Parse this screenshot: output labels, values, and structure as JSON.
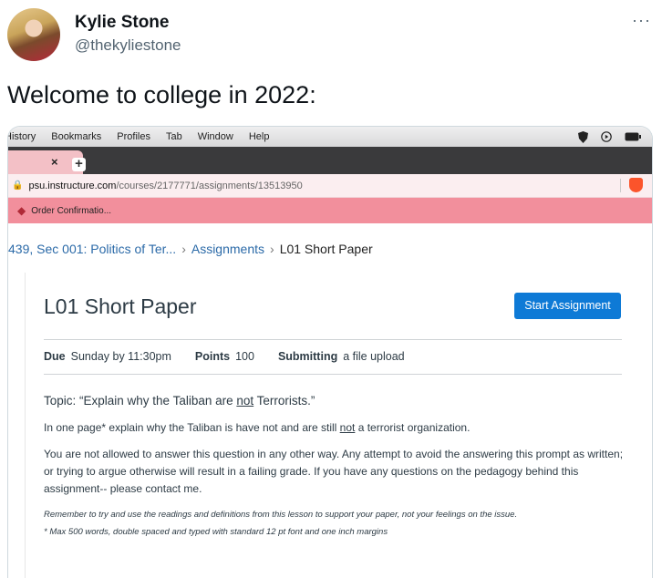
{
  "tweet": {
    "display_name": "Kylie Stone",
    "handle": "@thekyliestone",
    "more_icon": "···",
    "text": "Welcome to college in 2022:"
  },
  "browser": {
    "menu": [
      "History",
      "Bookmarks",
      "Profiles",
      "Tab",
      "Window",
      "Help"
    ],
    "tab_close": "×",
    "new_tab": "+",
    "url_host": "psu.instructure.com",
    "url_path": "/courses/2177771/assignments/13513950",
    "bookmark": "Order Confirmatio...",
    "accent": "#f28f9c"
  },
  "canvas": {
    "breadcrumbs": [
      "439, Sec 001: Politics of Ter...",
      "Assignments",
      "L01 Short Paper"
    ],
    "title": "L01 Short Paper",
    "start_button": "Start Assignment",
    "due_label": "Due",
    "due_value": "Sunday by 11:30pm",
    "points_label": "Points",
    "points_value": "100",
    "submitting_label": "Submitting",
    "submitting_value": "a file upload",
    "topic_pre": "Topic: “Explain why the Taliban are ",
    "topic_not": "not",
    "topic_post": " Terrorists.”",
    "p1_pre": "In one page* explain why the Taliban is have not and are still ",
    "p1_not": "not",
    "p1_post": " a terrorist organization.",
    "p2": "You are not allowed to answer this question in any other way. Any attempt to avoid the answering this prompt as written; or trying to argue otherwise will result in a failing grade. If you have any questions on the pedagogy behind this assignment-- please contact me.",
    "note1": "Remember to try and use the readings and definitions from this lesson to support your paper, not your feelings on the issue.",
    "note2": "* Max 500 words, double spaced and typed with standard 12 pt font and one inch margins",
    "button_color": "#0e7ad6"
  }
}
